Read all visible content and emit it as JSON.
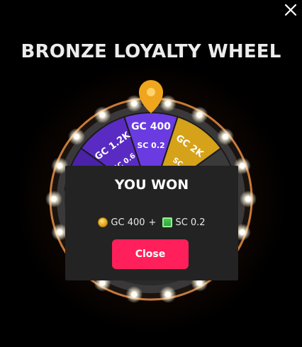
{
  "title": "BRONZE LOYALTY WHEEL",
  "wheel": {
    "segments": [
      {
        "gc": "GC 1.2K",
        "sc": "SC 0.6",
        "color": "#5a2bc2"
      },
      {
        "gc": "GC 400",
        "sc": "SC 0.2",
        "color": "#6a3be0"
      },
      {
        "gc": "GC 2K",
        "sc": "SC",
        "color": "#d5a21a"
      }
    ],
    "partial_label": "o"
  },
  "modal": {
    "title": "YOU WON",
    "gc_text": "GC 400",
    "plus": "+",
    "sc_text": "SC 0.2",
    "close_label": "Close"
  },
  "colors": {
    "background": "#000000",
    "accent": "#ff1f5a",
    "rim": "#c77a3a",
    "pointer": "#f0a51e"
  }
}
